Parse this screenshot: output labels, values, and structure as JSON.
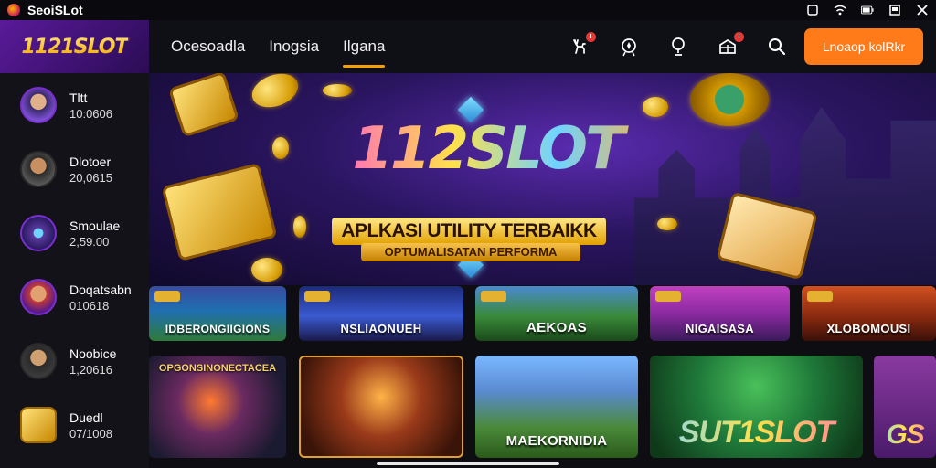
{
  "statusbar": {
    "app_name": "SeoiSLot",
    "icons": [
      "square-icon",
      "wifi-icon",
      "battery-icon",
      "window-icon",
      "close-icon"
    ]
  },
  "header": {
    "logo_text": "1121SLOT",
    "tabs": [
      {
        "label": "Ocesoadla",
        "active": false
      },
      {
        "label": "Inogsia",
        "active": false
      },
      {
        "label": "Ilgana",
        "active": true
      }
    ],
    "icons": [
      "deer-icon",
      "target-icon",
      "trophy-icon",
      "gift-icon",
      "search-icon"
    ],
    "cta_label": "Lnoaop kolRkr",
    "accent": "#ff7a18"
  },
  "sidebar": {
    "items": [
      {
        "name": "Tltt",
        "value": "10:0606"
      },
      {
        "name": "Dlotoer",
        "value": "20,0615"
      },
      {
        "name": "Smoulae",
        "value": "2,59.00"
      },
      {
        "name": "Doqatsabn",
        "value": "010618"
      },
      {
        "name": "Noobice",
        "value": "1,20616"
      },
      {
        "name": "Duedl",
        "value": "07/1008"
      }
    ]
  },
  "banner": {
    "title": "112SLOT",
    "subtitle1": "APLKASI UTILITY TERBAIKK",
    "subtitle2": "OPTUMALISATAN PERFORMA"
  },
  "games_row1": [
    {
      "title": "IDBERONGIIGIONS"
    },
    {
      "title": "NSLIAONUEH"
    },
    {
      "title": "AEKOAS"
    },
    {
      "title": "NIGAISASA"
    },
    {
      "title": "XLOBOMOUSI"
    }
  ],
  "games_row2": [
    {
      "title": "OPGONSINONECTACEA"
    },
    {
      "title": ""
    },
    {
      "title": "MAEKORNIDIA"
    },
    {
      "title": "SUT1SLOT"
    },
    {
      "title": "GS"
    }
  ]
}
